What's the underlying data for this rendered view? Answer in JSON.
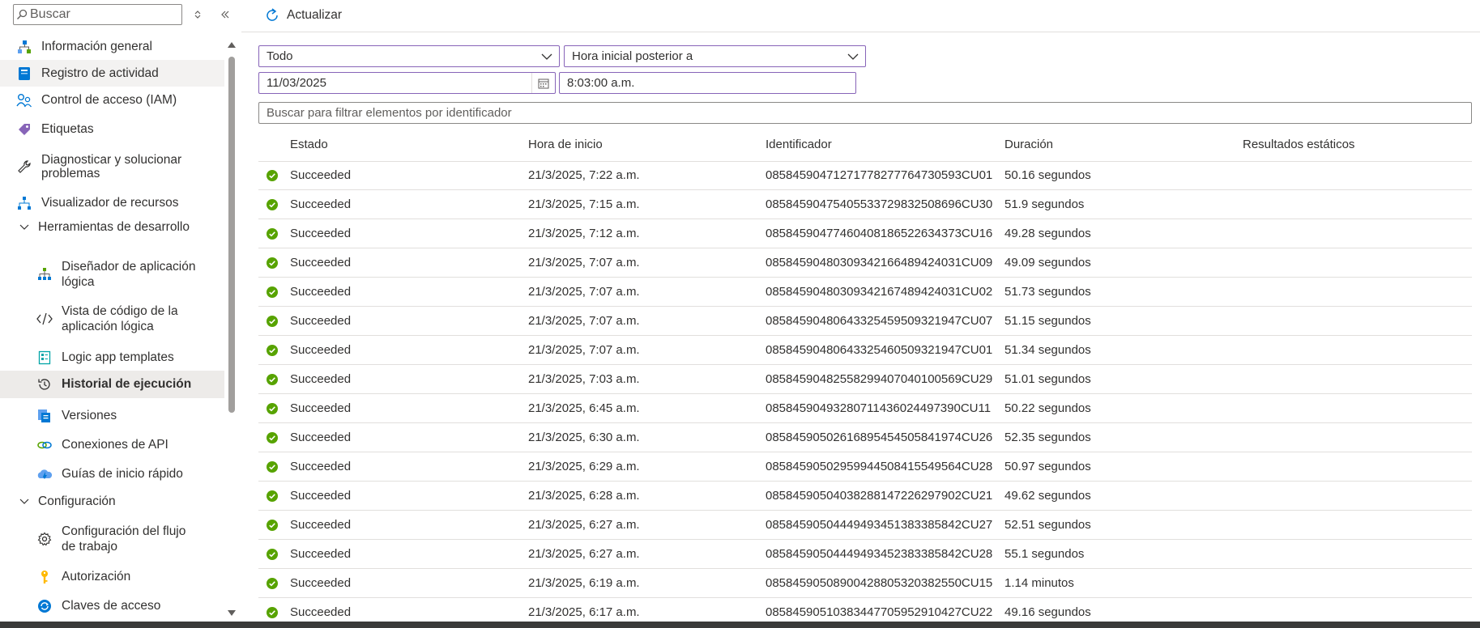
{
  "sidebar": {
    "search_placeholder": "Buscar",
    "items": [
      {
        "label": "Información general",
        "icon": "overview-icon"
      },
      {
        "label": "Registro de actividad",
        "icon": "activity-log-icon"
      },
      {
        "label": "Control de acceso (IAM)",
        "icon": "iam-icon"
      },
      {
        "label": "Etiquetas",
        "icon": "tag-icon"
      },
      {
        "label": "Diagnosticar y solucionar problemas",
        "line1": "Diagnosticar y solucionar",
        "line2": "problemas",
        "icon": "wrench-icon"
      },
      {
        "label": "Visualizador de recursos",
        "icon": "resource-visualizer-icon"
      },
      {
        "label": "Herramientas de desarrollo",
        "icon": "chevron-down-icon"
      },
      {
        "label": "Diseñador de aplicación lógica",
        "line1": "Diseñador de aplicación",
        "line2": "lógica",
        "icon": "designer-icon"
      },
      {
        "label": "Vista de código de la aplicación lógica",
        "line1": "Vista de código de la",
        "line2": "aplicación lógica",
        "icon": "code-icon"
      },
      {
        "label": "Logic app templates",
        "icon": "templates-icon"
      },
      {
        "label": "Historial de ejecución",
        "icon": "history-icon"
      },
      {
        "label": "Versiones",
        "icon": "versions-icon"
      },
      {
        "label": "Conexiones de API",
        "icon": "api-connections-icon"
      },
      {
        "label": "Guías de inicio rápido",
        "icon": "quickstart-icon"
      },
      {
        "label": "Configuración",
        "icon": "chevron-down-icon"
      },
      {
        "label": "Configuración del flujo de trabajo",
        "line1": "Configuración del flujo",
        "line2": "de trabajo",
        "icon": "gear-icon"
      },
      {
        "label": "Autorización",
        "icon": "key-icon"
      },
      {
        "label": "Claves de acceso",
        "icon": "access-keys-icon"
      }
    ]
  },
  "toolbar": {
    "refresh_label": "Actualizar"
  },
  "filters": {
    "status_value": "Todo",
    "time_filter_value": "Hora inicial posterior a",
    "date_value": "11/03/2025",
    "time_value": "8:03:00 a.m.",
    "search_placeholder": "Buscar para filtrar elementos por identificador"
  },
  "table": {
    "columns": [
      "Estado",
      "Hora de inicio",
      "Identificador",
      "Duración",
      "Resultados estáticos"
    ],
    "rows": [
      {
        "status": "Succeeded",
        "start": "21/3/2025, 7:22 a.m.",
        "id": "08584590471271778277764730593CU01",
        "duration": "50.16 segundos"
      },
      {
        "status": "Succeeded",
        "start": "21/3/2025, 7:15 a.m.",
        "id": "08584590475405533729832508696CU30",
        "duration": "51.9 segundos"
      },
      {
        "status": "Succeeded",
        "start": "21/3/2025, 7:12 a.m.",
        "id": "08584590477460408186522634373CU16",
        "duration": "49.28 segundos"
      },
      {
        "status": "Succeeded",
        "start": "21/3/2025, 7:07 a.m.",
        "id": "08584590480309342166489424031CU09",
        "duration": "49.09 segundos"
      },
      {
        "status": "Succeeded",
        "start": "21/3/2025, 7:07 a.m.",
        "id": "08584590480309342167489424031CU02",
        "duration": "51.73 segundos"
      },
      {
        "status": "Succeeded",
        "start": "21/3/2025, 7:07 a.m.",
        "id": "08584590480643325459509321947CU07",
        "duration": "51.15 segundos"
      },
      {
        "status": "Succeeded",
        "start": "21/3/2025, 7:07 a.m.",
        "id": "08584590480643325460509321947CU01",
        "duration": "51.34 segundos"
      },
      {
        "status": "Succeeded",
        "start": "21/3/2025, 7:03 a.m.",
        "id": "08584590482558299407040100569CU29",
        "duration": "51.01 segundos"
      },
      {
        "status": "Succeeded",
        "start": "21/3/2025, 6:45 a.m.",
        "id": "08584590493280711436024497390CU11",
        "duration": "50.22 segundos"
      },
      {
        "status": "Succeeded",
        "start": "21/3/2025, 6:30 a.m.",
        "id": "08584590502616895454505841974CU26",
        "duration": "52.35 segundos"
      },
      {
        "status": "Succeeded",
        "start": "21/3/2025, 6:29 a.m.",
        "id": "08584590502959944508415549564CU28",
        "duration": "50.97 segundos"
      },
      {
        "status": "Succeeded",
        "start": "21/3/2025, 6:28 a.m.",
        "id": "08584590504038288147226297902CU21",
        "duration": "49.62 segundos"
      },
      {
        "status": "Succeeded",
        "start": "21/3/2025, 6:27 a.m.",
        "id": "08584590504449493451383385842CU27",
        "duration": "52.51 segundos"
      },
      {
        "status": "Succeeded",
        "start": "21/3/2025, 6:27 a.m.",
        "id": "08584590504449493452383385842CU28",
        "duration": "55.1 segundos"
      },
      {
        "status": "Succeeded",
        "start": "21/3/2025, 6:19 a.m.",
        "id": "08584590508900428805320382550CU15",
        "duration": "1.14 minutos"
      },
      {
        "status": "Succeeded",
        "start": "21/3/2025, 6:17 a.m.",
        "id": "08584590510383447705952910427CU22",
        "duration": "49.16 segundos"
      }
    ]
  },
  "colors": {
    "accent": "#0078d4",
    "success": "#57a300",
    "filter_border": "#8764b8",
    "selected_bg": "#edebe9"
  }
}
